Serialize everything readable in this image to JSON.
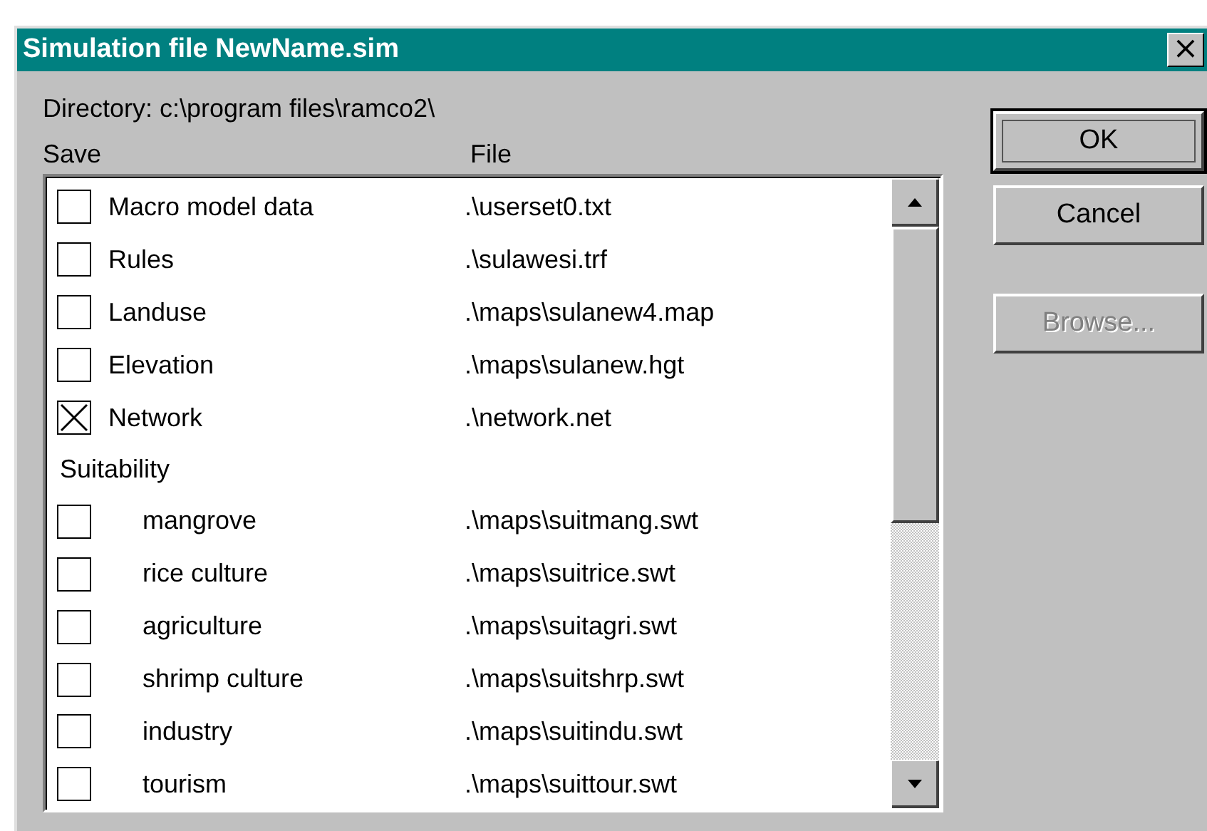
{
  "window": {
    "title": "Simulation file NewName.sim",
    "close": "×"
  },
  "directory": "Directory: c:\\program files\\ramco2\\",
  "columns": [
    "Save",
    "File"
  ],
  "rows": [
    {
      "label": "Macro model data",
      "file": ".\\userset0.txt",
      "checked": false
    },
    {
      "label": "Rules",
      "file": ".\\sulawesi.trf",
      "checked": false
    },
    {
      "label": "Landuse",
      "file": ".\\maps\\sulanew4.map",
      "checked": false
    },
    {
      "label": "Elevation",
      "file": ".\\maps\\sulanew.hgt",
      "checked": false
    },
    {
      "label": "Network",
      "file": ".\\network.net",
      "checked": true
    },
    {
      "label": "Suitability",
      "children": [
        {
          "label": "mangrove",
          "file": ".\\maps\\suitmang.swt",
          "checked": false
        },
        {
          "label": "rice culture",
          "file": ".\\maps\\suitrice.swt",
          "checked": false
        },
        {
          "label": "agriculture",
          "file": ".\\maps\\suitagri.swt",
          "checked": false
        },
        {
          "label": "shrimp culture",
          "file": ".\\maps\\suitshrp.swt",
          "checked": false
        },
        {
          "label": "industry",
          "file": ".\\maps\\suitindu.swt",
          "checked": false
        },
        {
          "label": "tourism",
          "file": ".\\maps\\suittour.swt",
          "checked": false
        }
      ]
    }
  ],
  "buttons": [
    {
      "label": "OK",
      "default": true,
      "disabled": false
    },
    {
      "label": "Cancel",
      "default": false,
      "disabled": false
    },
    {
      "label": "Browse...",
      "default": false,
      "disabled": true
    }
  ]
}
